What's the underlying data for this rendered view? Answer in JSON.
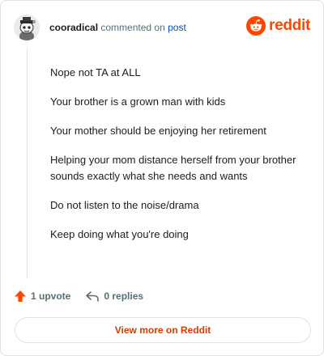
{
  "header": {
    "username": "cooradical",
    "action_text": "commented on",
    "post_link": "post",
    "brand": "reddit"
  },
  "comment": {
    "paragraphs": [
      "Nope not TA at ALL",
      "Your brother is a grown man with kids",
      "Your mother should be enjoying her retirement",
      "Helping your mom distance herself from your brother sounds exactly what she needs and wants",
      "Do not listen to the noise/drama",
      "Keep doing what you're doing"
    ]
  },
  "actions": {
    "upvote_label": "1 upvote",
    "replies_label": "0 replies"
  },
  "footer": {
    "view_more_label": "View more on Reddit"
  },
  "colors": {
    "accent": "#ff4500",
    "link": "#0a4fa8",
    "muted": "#576f76"
  },
  "icons": {
    "avatar": "snoo-avatar",
    "logo": "reddit-logo-icon",
    "upvote": "upvote-arrow-icon",
    "reply": "reply-arrow-icon"
  }
}
